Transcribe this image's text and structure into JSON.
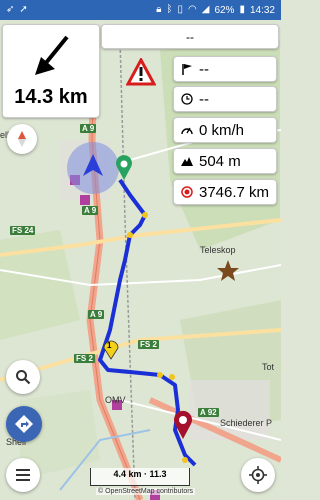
{
  "status_bar": {
    "left_icons": [
      "navigation-app-icon",
      "route-icon"
    ],
    "right_icons": [
      "lock-icon",
      "bluetooth-icon",
      "vibrate-icon",
      "wifi-icon",
      "signal-icon"
    ],
    "battery": "62%",
    "time": "14:32",
    "bar_color": "#2c66b5"
  },
  "navigation": {
    "distance": "14.3 km",
    "turn_direction": "arrow-down-left-icon"
  },
  "top_strip": {
    "value": "--"
  },
  "warning": {
    "icon": "warning-triangle-icon"
  },
  "info_rows": [
    {
      "icon": "flag-icon",
      "value": "--"
    },
    {
      "icon": "clock-icon",
      "value": "--"
    },
    {
      "icon": "speedometer-icon",
      "value": "0 km/h"
    },
    {
      "icon": "mountain-icon",
      "value": "504 m"
    },
    {
      "icon": "record-icon",
      "value": "3746.7 km"
    }
  ],
  "map": {
    "labels": [
      "ellen",
      "Teleskop",
      "OMV",
      "Schiederer P",
      "Tot",
      "Shell"
    ],
    "road_labels": [
      "A 9",
      "A 9",
      "FS 24",
      "A 9",
      "FS 2",
      "FS 2",
      "A 92"
    ],
    "route_color": "#1a2fd6",
    "waypoint_label": "1"
  },
  "scale_bar": {
    "label": "4.4 km · 11.3"
  },
  "attribution": "© OpenStreetMap contributors",
  "controls": {
    "compass": "compass-icon",
    "search": "search-icon",
    "directions": "directions-icon",
    "menu": "menu-icon",
    "my_location": "my-location-icon"
  }
}
